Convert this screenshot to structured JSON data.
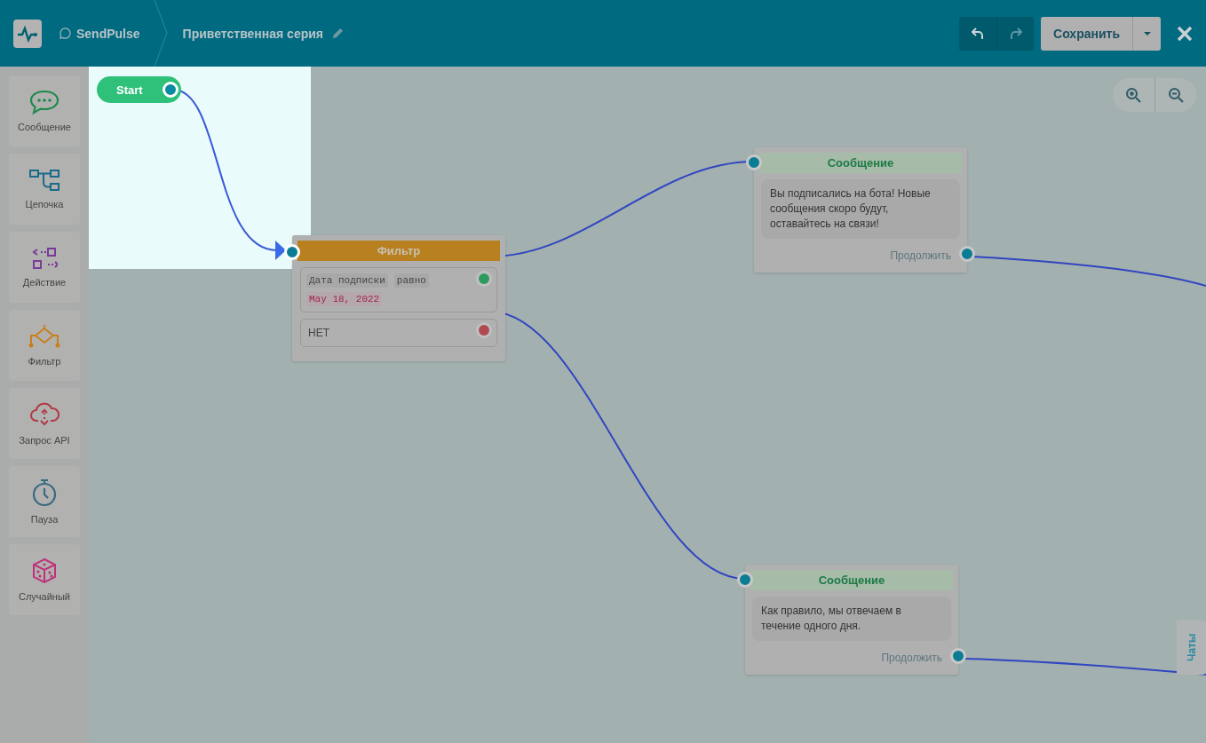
{
  "header": {
    "channel": "SendPulse",
    "title": "Приветственная серия",
    "history": [
      {
        "kind": "undo",
        "disabled": false
      },
      {
        "kind": "redo",
        "disabled": true
      }
    ],
    "save_button": "Сохранить"
  },
  "sidebar": {
    "items": [
      {
        "kind": "message",
        "label": "Сообщение"
      },
      {
        "kind": "chain",
        "label": "Цепочка"
      },
      {
        "kind": "action",
        "label": "Действие"
      },
      {
        "kind": "filter",
        "label": "Фильтр"
      },
      {
        "kind": "api",
        "label": "Запрос API"
      },
      {
        "kind": "pause",
        "label": "Пауза"
      },
      {
        "kind": "random",
        "label": "Случайный"
      }
    ]
  },
  "canvas": {
    "start": {
      "label": "Start"
    },
    "filter": {
      "title": "Фильтр",
      "branches": [
        {
          "kind": "condition",
          "tags": [
            "Дата подписки",
            "равно"
          ],
          "value": "May 18, 2022",
          "color": "#2e9a5c"
        },
        {
          "kind": "else",
          "label": "НЕТ",
          "color": "#b04a50"
        }
      ]
    },
    "messages": [
      {
        "title": "Сообщение",
        "text": "Вы подписались на бота! Новые сообщения скоро будут, оставайтесь на связи!",
        "continue": "Продолжить"
      },
      {
        "title": "Сообщение",
        "text": "Как правило, мы отвечаем в течение одного дня.",
        "continue": "Продолжить"
      }
    ],
    "side_tab": "Чаты"
  }
}
